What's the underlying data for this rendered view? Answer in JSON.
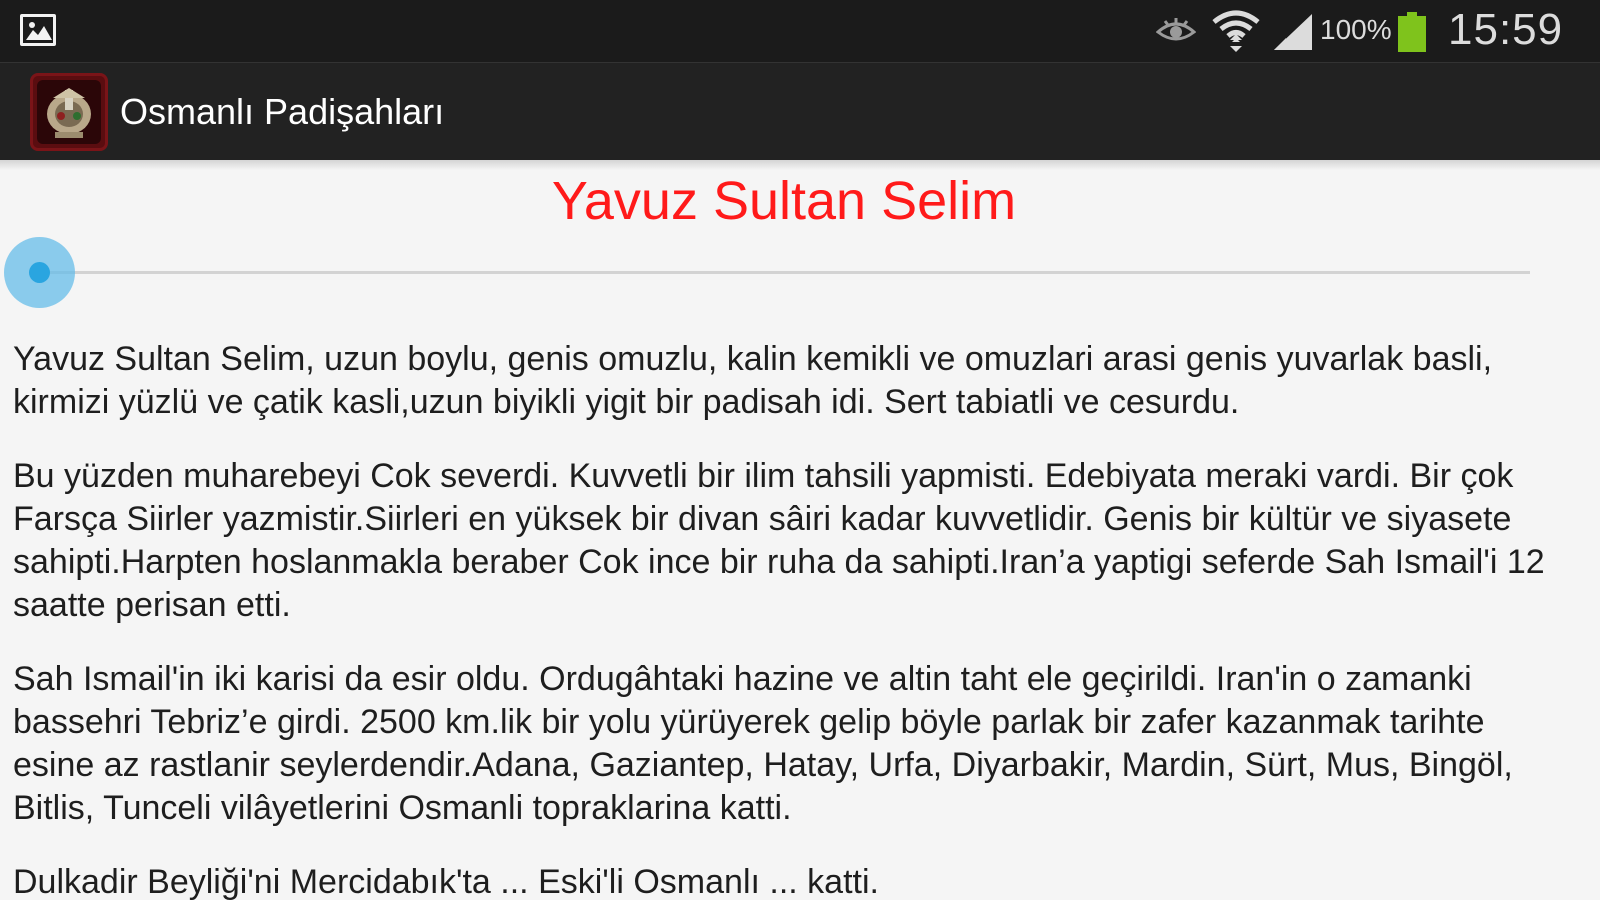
{
  "status_bar": {
    "icons": [
      "gallery-icon",
      "smart-stay-eye-icon",
      "wifi-icon",
      "cell-signal-icon",
      "battery-icon"
    ],
    "battery_percent": "100%",
    "battery_level": 1.0,
    "time": "15:59",
    "battery_color": "#7fc31c"
  },
  "action_bar": {
    "title": "Osmanlı Padişahları",
    "icon": "ottoman-coat-of-arms-icon"
  },
  "main": {
    "heading": "Yavuz Sultan Selim",
    "heading_color": "#ff1a1a",
    "audio_progress": 0.0,
    "paragraphs": [
      "Yavuz Sultan Selim, uzun boylu, genis omuzlu, kalin kemikli ve omuzlari arasi genis yuvarlak basli, kirmizi yüzlü ve çatik kasli,uzun biyikli yigit bir padisah idi. Sert tabiatli ve cesurdu.",
      "Bu yüzden muharebeyi Cok severdi. Kuvvetli bir ilim tahsili yapmisti. Edebiyata meraki vardi. Bir çok Farsça Siirler yazmistir.Siirleri en yüksek bir divan sâiri kadar kuvvetlidir. Genis bir kültür ve siyasete sahipti.Harpten hoslanmakla beraber Cok ince bir ruha da sahipti.Iran’a yaptigi seferde Sah Ismail'i 12 saatte perisan etti.",
      "Sah Ismail'in iki karisi da esir oldu. Ordugâhtaki hazine ve altin taht ele geçirildi. Iran'in o zamanki bassehri Tebriz’e girdi. 2500 km.lik bir yolu yürüyerek gelip böyle parlak bir zafer kazanmak tarihte esine az rastlanir seylerdendir.Adana, Gaziantep, Hatay, Urfa, Diyarbakir, Mardin, Sürt, Mus, Bingöl, Bitlis, Tunceli vilâyetlerini Osmanli topraklarina katti.",
      "Dulkadir Beyliği'ni Mercidabık'ta ... Eski'li Osmanlı ... katti."
    ]
  }
}
